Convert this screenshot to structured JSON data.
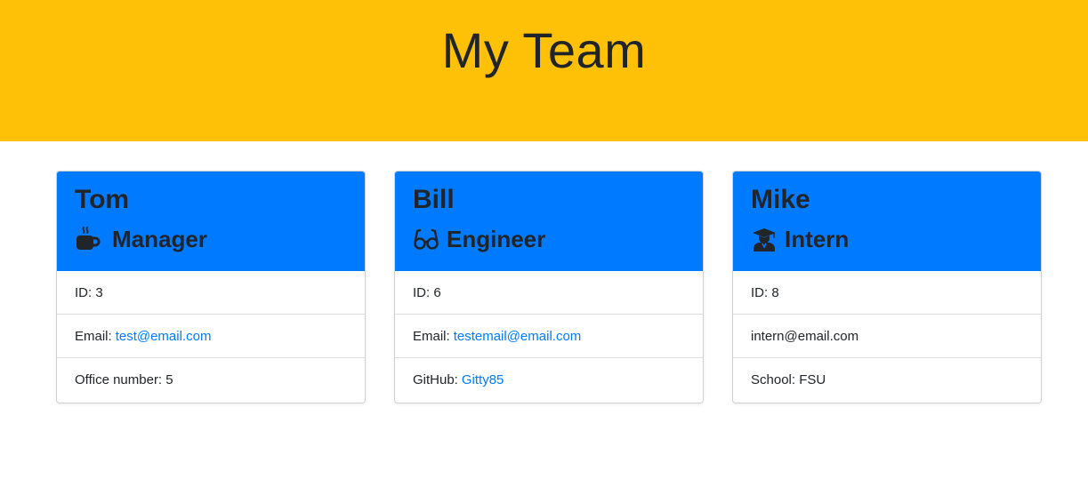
{
  "header": {
    "title": "My Team",
    "background": "#ffc107"
  },
  "colors": {
    "card_header": "#007bff",
    "link": "#007bff",
    "text": "#212529"
  },
  "cards": [
    {
      "name": "Tom",
      "role": "Manager",
      "icon": "coffee-mug-icon",
      "id_text": "ID: 3",
      "email_label": "Email:",
      "email": "test@email.com",
      "extra_label": "Office number: 5"
    },
    {
      "name": "Bill",
      "role": "Engineer",
      "icon": "glasses-icon",
      "id_text": "ID: 6",
      "email_label": "Email:",
      "email": "testemail@email.com",
      "extra_label": "GitHub:",
      "extra_link": "Gitty85"
    },
    {
      "name": "Mike",
      "role": "Intern",
      "icon": "graduate-icon",
      "id_text": "ID: 8",
      "email": "intern@email.com",
      "extra_label": "School: FSU"
    }
  ]
}
